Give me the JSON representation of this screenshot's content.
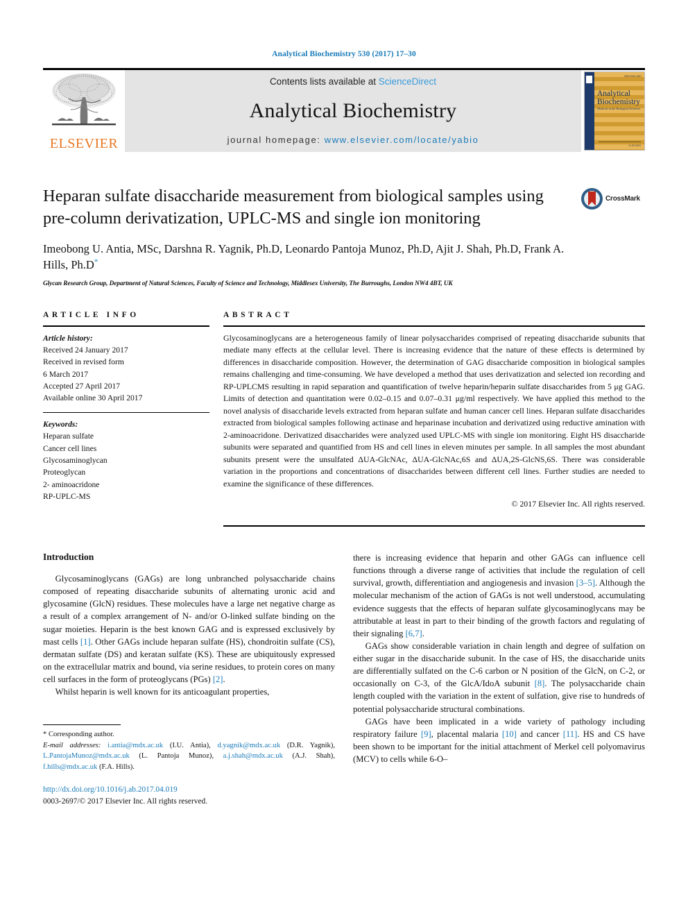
{
  "running_head": "Analytical Biochemistry 530 (2017) 17–30",
  "masthead": {
    "publisher_name": "ELSEVIER",
    "contents_prefix": "Contents lists available at ",
    "contents_link": "ScienceDirect",
    "journal_title": "Analytical Biochemistry",
    "homepage_prefix": "journal homepage: ",
    "homepage_url": "www.elsevier.com/locate/yabio",
    "cover": {
      "line1": "Analytical",
      "line2": "Biochemistry",
      "line3": "Methods in the Biological Sciences",
      "top_code": "ISSN 0003-2697",
      "bottom_code": "ELSEVIER"
    }
  },
  "article": {
    "title": "Heparan sulfate disaccharide measurement from biological samples using pre-column derivatization, UPLC-MS and single ion monitoring",
    "crossmark_label": "CrossMark",
    "authors": "Imeobong U. Antia, MSc, Darshna R. Yagnik, Ph.D, Leonardo Pantoja Munoz, Ph.D, Ajit J. Shah, Ph.D, Frank A. Hills, Ph.D",
    "affiliation": "Glycan Research Group, Department of Natural Sciences, Faculty of Science and Technology, Middlesex University, The Burroughs, London NW4 4BT, UK"
  },
  "article_info": {
    "heading": "ARTICLE INFO",
    "history_label": "Article history:",
    "history": [
      "Received 24 January 2017",
      "Received in revised form",
      "6 March 2017",
      "Accepted 27 April 2017",
      "Available online 30 April 2017"
    ],
    "keywords_label": "Keywords:",
    "keywords": [
      "Heparan sulfate",
      "Cancer cell lines",
      "Glycosaminoglycan",
      "Proteoglycan",
      "2- aminoacridone",
      "RP-UPLC-MS"
    ]
  },
  "abstract": {
    "heading": "ABSTRACT",
    "text": "Glycosaminoglycans are a heterogeneous family of linear polysaccharides comprised of repeating disaccharide subunits that mediate many effects at the cellular level. There is increasing evidence that the nature of these effects is determined by differences in disaccharide composition. However, the determination of GAG disaccharide composition in biological samples remains challenging and time-consuming. We have developed a method that uses derivatization and selected ion recording and RP-UPLCMS resulting in rapid separation and quantification of twelve heparin/heparin sulfate disaccharides from 5 μg GAG. Limits of detection and quantitation were 0.02–0.15 and 0.07–0.31 μg/ml respectively. We have applied this method to the novel analysis of disaccharide levels extracted from heparan sulfate and human cancer cell lines. Heparan sulfate disaccharides extracted from biological samples following actinase and heparinase incubation and derivatized using reductive amination with 2-aminoacridone. Derivatized disaccharides were analyzed used UPLC-MS with single ion monitoring. Eight HS disaccharide subunits were separated and quantified from HS and cell lines in eleven minutes per sample. In all samples the most abundant subunits present were the unsulfated ΔUA-GlcNAc, ΔUA-GlcNAc,6S and ΔUA,2S-GlcNS,6S. There was considerable variation in the proportions and concentrations of disaccharides between different cell lines. Further studies are needed to examine the significance of these differences.",
    "copyright": "© 2017 Elsevier Inc. All rights reserved."
  },
  "body": {
    "intro_heading": "Introduction",
    "left_p1_a": "Glycosaminoglycans (GAGs) are long unbranched polysaccharide chains composed of repeating disaccharide subunits of alternating uronic acid and glycosamine (GlcN) residues. These molecules have a large net negative charge as a result of a complex arrangement of N- and/or O-linked sulfate binding on the sugar moieties. Heparin is the best known GAG and is expressed exclusively by mast cells ",
    "left_p1_r1": "[1]",
    "left_p1_b": ". Other GAGs include heparan sulfate (HS), chondroitin sulfate (CS), dermatan sulfate (DS) and keratan sulfate (KS). These are ubiquitously expressed on the extracellular matrix and bound, via serine residues, to protein cores on many cell surfaces in the form of proteoglycans (PGs) ",
    "left_p1_r2": "[2]",
    "left_p1_c": ".",
    "left_p2": "Whilst heparin is well known for its anticoagulant properties,",
    "right_p1_a": "there is increasing evidence that heparin and other GAGs can influence cell functions through a diverse range of activities that include the regulation of cell survival, growth, differentiation and angiogenesis and invasion ",
    "right_p1_r1": "[3–5]",
    "right_p1_b": ". Although the molecular mechanism of the action of GAGs is not well understood, accumulating evidence suggests that the effects of heparan sulfate glycosaminoglycans may be attributable at least in part to their binding of the growth factors and regulating of their signaling ",
    "right_p1_r2": "[6,7]",
    "right_p1_c": ".",
    "right_p2_a": "GAGs show considerable variation in chain length and degree of sulfation on either sugar in the disaccharide subunit. In the case of HS, the disaccharide units are differentially sulfated on the C-6 carbon or N position of the GlcN, on C-2, or occasionally on C-3, of the GlcA/IdoA subunit ",
    "right_p2_r1": "[8]",
    "right_p2_b": ". The polysaccharide chain length coupled with the variation in the extent of sulfation, give rise to hundreds of potential polysaccharide structural combinations.",
    "right_p3_a": "GAGs have been implicated in a wide variety of pathology including respiratory failure ",
    "right_p3_r1": "[9]",
    "right_p3_b": ", placental malaria ",
    "right_p3_r2": "[10]",
    "right_p3_c": " and cancer ",
    "right_p3_r3": "[11]",
    "right_p3_d": ". HS and CS have been shown to be important for the initial attachment of Merkel cell polyomavirus (MCV) to cells while 6-O–"
  },
  "footnote": {
    "corresponding": "* Corresponding author.",
    "email_label": "E-mail addresses:",
    "emails": [
      {
        "address": "i.antia@mdx.ac.uk",
        "person": " (I.U. Antia), "
      },
      {
        "address": "d.yagnik@mdx.ac.uk",
        "person": " (D.R. Yagnik), "
      },
      {
        "address": "L.PantojaMunoz@mdx.ac.uk",
        "person": " (L. Pantoja Munoz), "
      },
      {
        "address": "a.j.shah@mdx.ac.uk",
        "person": " (A.J. Shah), "
      },
      {
        "address": "f.hills@mdx.ac.uk",
        "person": " (F.A. Hills)."
      }
    ],
    "doi": "http://dx.doi.org/10.1016/j.ab.2017.04.019",
    "issn": "0003-2697/© 2017 Elsevier Inc. All rights reserved."
  },
  "colors": {
    "link": "#1a7bb9",
    "elsevier_orange": "#E87722",
    "band_gray": "#e4e4e4"
  }
}
